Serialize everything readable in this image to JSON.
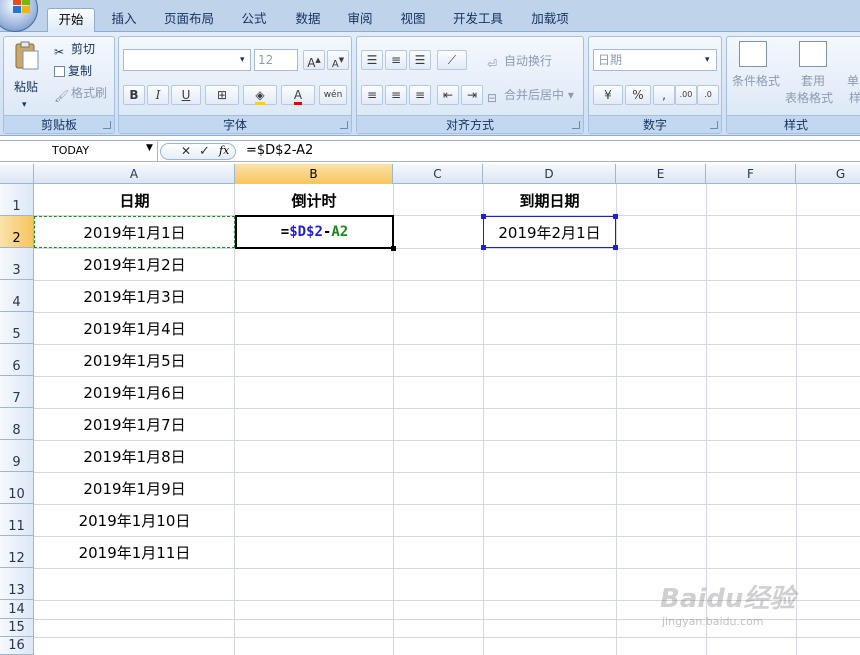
{
  "ribbon_tabs": [
    "开始",
    "插入",
    "页面布局",
    "公式",
    "数据",
    "审阅",
    "视图",
    "开发工具",
    "加载项"
  ],
  "clipboard": {
    "paste": "粘贴",
    "cut": "剪切",
    "copy": "复制",
    "format_painter": "格式刷",
    "label": "剪贴板"
  },
  "font": {
    "name_value": "",
    "size_value": "12",
    "bold": "B",
    "italic": "I",
    "underline": "U",
    "grow": "A",
    "shrink": "A",
    "label": "字体"
  },
  "alignment": {
    "wrap_text": "自动换行",
    "merge_center": "合并后居中",
    "label": "对齐方式"
  },
  "number": {
    "format_value": "日期",
    "currency": "%",
    "comma": ",",
    "label": "数字"
  },
  "styles": {
    "conditional": "条件格式",
    "table_format_1": "套用",
    "table_format_2": "表格格式",
    "cell_styles_1": "单",
    "cell_styles_2": "样",
    "label": "样式"
  },
  "formula_bar": {
    "name_box": "TODAY",
    "fx": "fx",
    "formula": "=$D$2-A2",
    "cancel": "✕",
    "enter": "✓"
  },
  "columns": [
    "A",
    "B",
    "C",
    "D",
    "E",
    "F",
    "G"
  ],
  "rows": [
    "1",
    "2",
    "3",
    "4",
    "5",
    "6",
    "7",
    "8",
    "9",
    "10",
    "11",
    "12",
    "13",
    "14",
    "15",
    "16"
  ],
  "cells": {
    "A1": "日期",
    "B1": "倒计时",
    "D1": "到期日期",
    "A2": "2019年1月1日",
    "A3": "2019年1月2日",
    "A4": "2019年1月3日",
    "A5": "2019年1月4日",
    "A6": "2019年1月5日",
    "A7": "2019年1月6日",
    "A8": "2019年1月7日",
    "A9": "2019年1月8日",
    "A10": "2019年1月9日",
    "A11": "2019年1月10日",
    "A12": "2019年1月11日",
    "D2": "2019年2月1日"
  },
  "edit_formula": {
    "eq": "=",
    "ref1": "$D$2",
    "op": "-",
    "ref2": "A2"
  },
  "watermark": {
    "brand": "Baidu经验",
    "url": "jingyan.baidu.com"
  },
  "colors": {
    "ref_blue": "#1f1fd6",
    "ref_green": "#1a8a1a",
    "selected_header": "#f7c55f"
  }
}
